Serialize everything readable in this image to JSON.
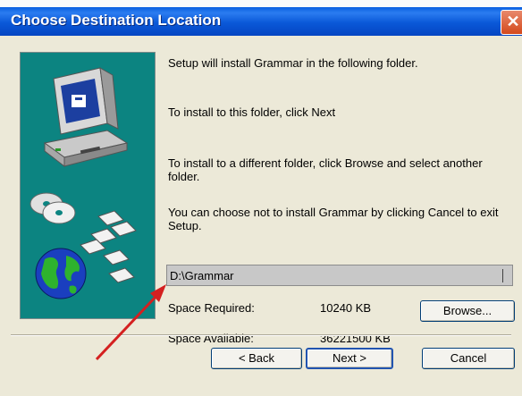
{
  "window": {
    "title": "Choose Destination Location",
    "close_glyph": "✕"
  },
  "content": {
    "line1": "Setup will install Grammar in the following folder.",
    "line2": "To install to this folder, click Next",
    "line3": "To install to a different folder, click Browse and select another folder.",
    "line4": "You can choose not to install Grammar by clicking Cancel to exit Setup."
  },
  "destination": {
    "path": "D:\\Grammar",
    "space_required_label": "Space Required:",
    "space_required_value": "10240 KB",
    "space_available_label": "Space Available:",
    "space_available_value": "36221500 KB"
  },
  "buttons": {
    "browse": "Browse...",
    "back": "< Back",
    "next": "Next >",
    "cancel": "Cancel"
  },
  "icons": [
    "computer-icon",
    "cd-discs-icon",
    "floppy-disks-icon",
    "globe-icon",
    "red-arrow-annotation"
  ],
  "colors": {
    "titlebar": "#0a58d8",
    "side_panel": "#0c8481",
    "annotation_arrow": "#d42020"
  }
}
